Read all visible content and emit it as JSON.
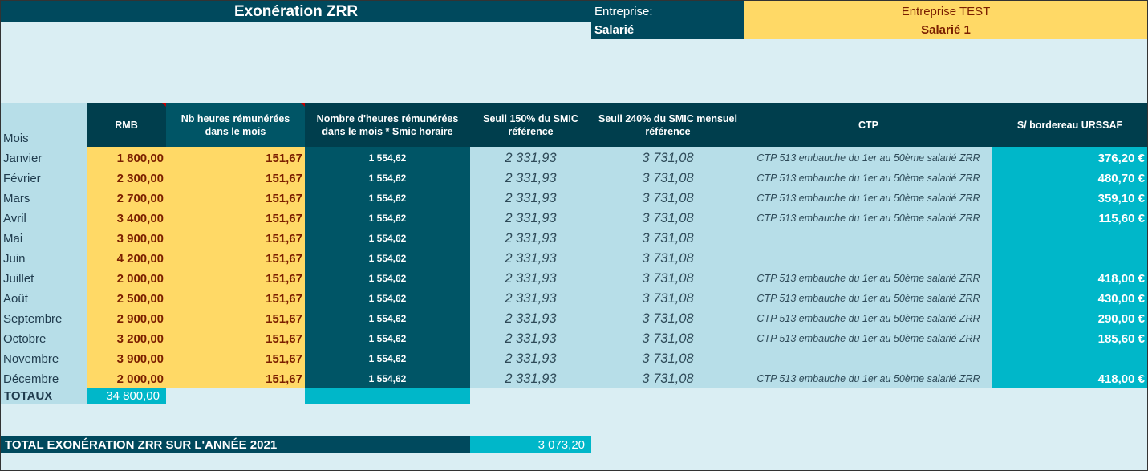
{
  "title": "Exonération ZRR",
  "company": {
    "label": "Entreprise:",
    "value": "Entreprise TEST"
  },
  "employee": {
    "label": "Salarié",
    "value": "Salarié 1"
  },
  "headers": {
    "mois": "Mois",
    "rmb": "RMB",
    "heures": "Nb heures rémunérées dans le mois",
    "heures_smic": "Nombre d'heures rémunérées dans le mois * Smic horaire",
    "seuil150": "Seuil 150% du SMIC référence",
    "seuil240": "Seuil 240% du SMIC mensuel référence",
    "ctp": "CTP",
    "urssaf": "S/ bordereau URSSAF"
  },
  "rows": [
    {
      "mois": "Janvier",
      "rmb": "1 800,00",
      "heures": "151,67",
      "smic": "1 554,62",
      "s150": "2 331,93",
      "s240": "3 731,08",
      "ctp": "CTP 513 embauche du 1er  au 50ème salarié ZRR",
      "urssaf": "376,20 €"
    },
    {
      "mois": "Février",
      "rmb": "2 300,00",
      "heures": "151,67",
      "smic": "1 554,62",
      "s150": "2 331,93",
      "s240": "3 731,08",
      "ctp": "CTP 513 embauche du 1er  au 50ème salarié ZRR",
      "urssaf": "480,70 €"
    },
    {
      "mois": "Mars",
      "rmb": "2 700,00",
      "heures": "151,67",
      "smic": "1 554,62",
      "s150": "2 331,93",
      "s240": "3 731,08",
      "ctp": "CTP 513 embauche du 1er  au 50ème salarié ZRR",
      "urssaf": "359,10 €"
    },
    {
      "mois": "Avril",
      "rmb": "3 400,00",
      "heures": "151,67",
      "smic": "1 554,62",
      "s150": "2 331,93",
      "s240": "3 731,08",
      "ctp": "CTP 513 embauche du 1er  au 50ème salarié ZRR",
      "urssaf": "115,60 €"
    },
    {
      "mois": "Mai",
      "rmb": "3 900,00",
      "heures": "151,67",
      "smic": "1 554,62",
      "s150": "2 331,93",
      "s240": "3 731,08",
      "ctp": "",
      "urssaf": ""
    },
    {
      "mois": "Juin",
      "rmb": "4 200,00",
      "heures": "151,67",
      "smic": "1 554,62",
      "s150": "2 331,93",
      "s240": "3 731,08",
      "ctp": "",
      "urssaf": ""
    },
    {
      "mois": "Juillet",
      "rmb": "2 000,00",
      "heures": "151,67",
      "smic": "1 554,62",
      "s150": "2 331,93",
      "s240": "3 731,08",
      "ctp": "CTP 513 embauche du 1er  au 50ème salarié ZRR",
      "urssaf": "418,00 €"
    },
    {
      "mois": "Août",
      "rmb": "2 500,00",
      "heures": "151,67",
      "smic": "1 554,62",
      "s150": "2 331,93",
      "s240": "3 731,08",
      "ctp": "CTP 513 embauche du 1er  au 50ème salarié ZRR",
      "urssaf": "430,00 €"
    },
    {
      "mois": "Septembre",
      "rmb": "2 900,00",
      "heures": "151,67",
      "smic": "1 554,62",
      "s150": "2 331,93",
      "s240": "3 731,08",
      "ctp": "CTP 513 embauche du 1er  au 50ème salarié ZRR",
      "urssaf": "290,00 €"
    },
    {
      "mois": "Octobre",
      "rmb": "3 200,00",
      "heures": "151,67",
      "smic": "1 554,62",
      "s150": "2 331,93",
      "s240": "3 731,08",
      "ctp": "CTP 513 embauche du 1er  au 50ème salarié ZRR",
      "urssaf": "185,60 €"
    },
    {
      "mois": "Novembre",
      "rmb": "3 900,00",
      "heures": "151,67",
      "smic": "1 554,62",
      "s150": "2 331,93",
      "s240": "3 731,08",
      "ctp": "",
      "urssaf": ""
    },
    {
      "mois": "Décembre",
      "rmb": "2 000,00",
      "heures": "151,67",
      "smic": "1 554,62",
      "s150": "2 331,93",
      "s240": "3 731,08",
      "ctp": "CTP 513 embauche du 1er  au 50ème salarié ZRR",
      "urssaf": "418,00 €"
    }
  ],
  "totals": {
    "label": "TOTAUX",
    "rmb": "34 800,00"
  },
  "annual": {
    "label": "TOTAL EXONÉRATION ZRR SUR L'ANNÉE 2021",
    "value": "3 073,20"
  },
  "colors": {
    "dark": "#00495d",
    "yellow": "#ffd966",
    "cyan": "#00b7c9",
    "light": "#b7dee8",
    "background": "#daeef3"
  }
}
